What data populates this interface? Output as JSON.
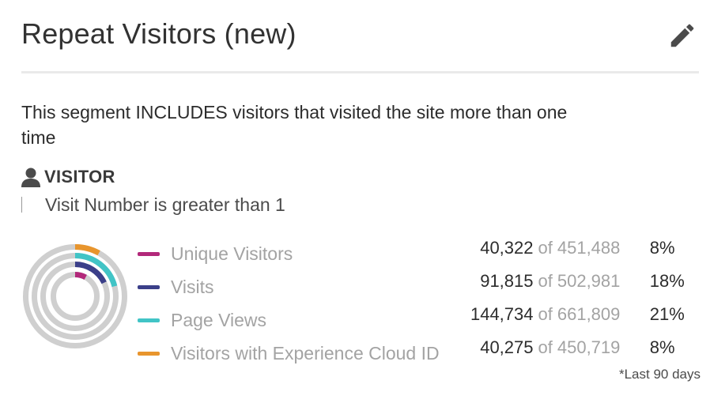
{
  "header": {
    "title": "Repeat Visitors (new)"
  },
  "description": "This segment INCLUDES visitors that visited the site more than one time",
  "container": {
    "label": "VISITOR",
    "rule": "Visit Number is greater than 1"
  },
  "metrics": [
    {
      "label": "Unique Visitors",
      "count": "40,322",
      "of": "of",
      "total": "451,488",
      "percent": "8%",
      "fraction": 0.08,
      "color": "#b2287a"
    },
    {
      "label": "Visits",
      "count": "91,815",
      "of": "of",
      "total": "502,981",
      "percent": "18%",
      "fraction": 0.18,
      "color": "#3b3f89"
    },
    {
      "label": "Page Views",
      "count": "144,734",
      "of": "of",
      "total": "661,809",
      "percent": "21%",
      "fraction": 0.21,
      "color": "#41c4c6"
    },
    {
      "label": "Visitors with Experience Cloud ID",
      "count": "40,275",
      "of": "of",
      "total": "450,719",
      "percent": "8%",
      "fraction": 0.08,
      "color": "#e8952d"
    }
  ],
  "footnote": "*Last 90 days",
  "colors": {
    "ring_track": "#cfcfcf"
  }
}
